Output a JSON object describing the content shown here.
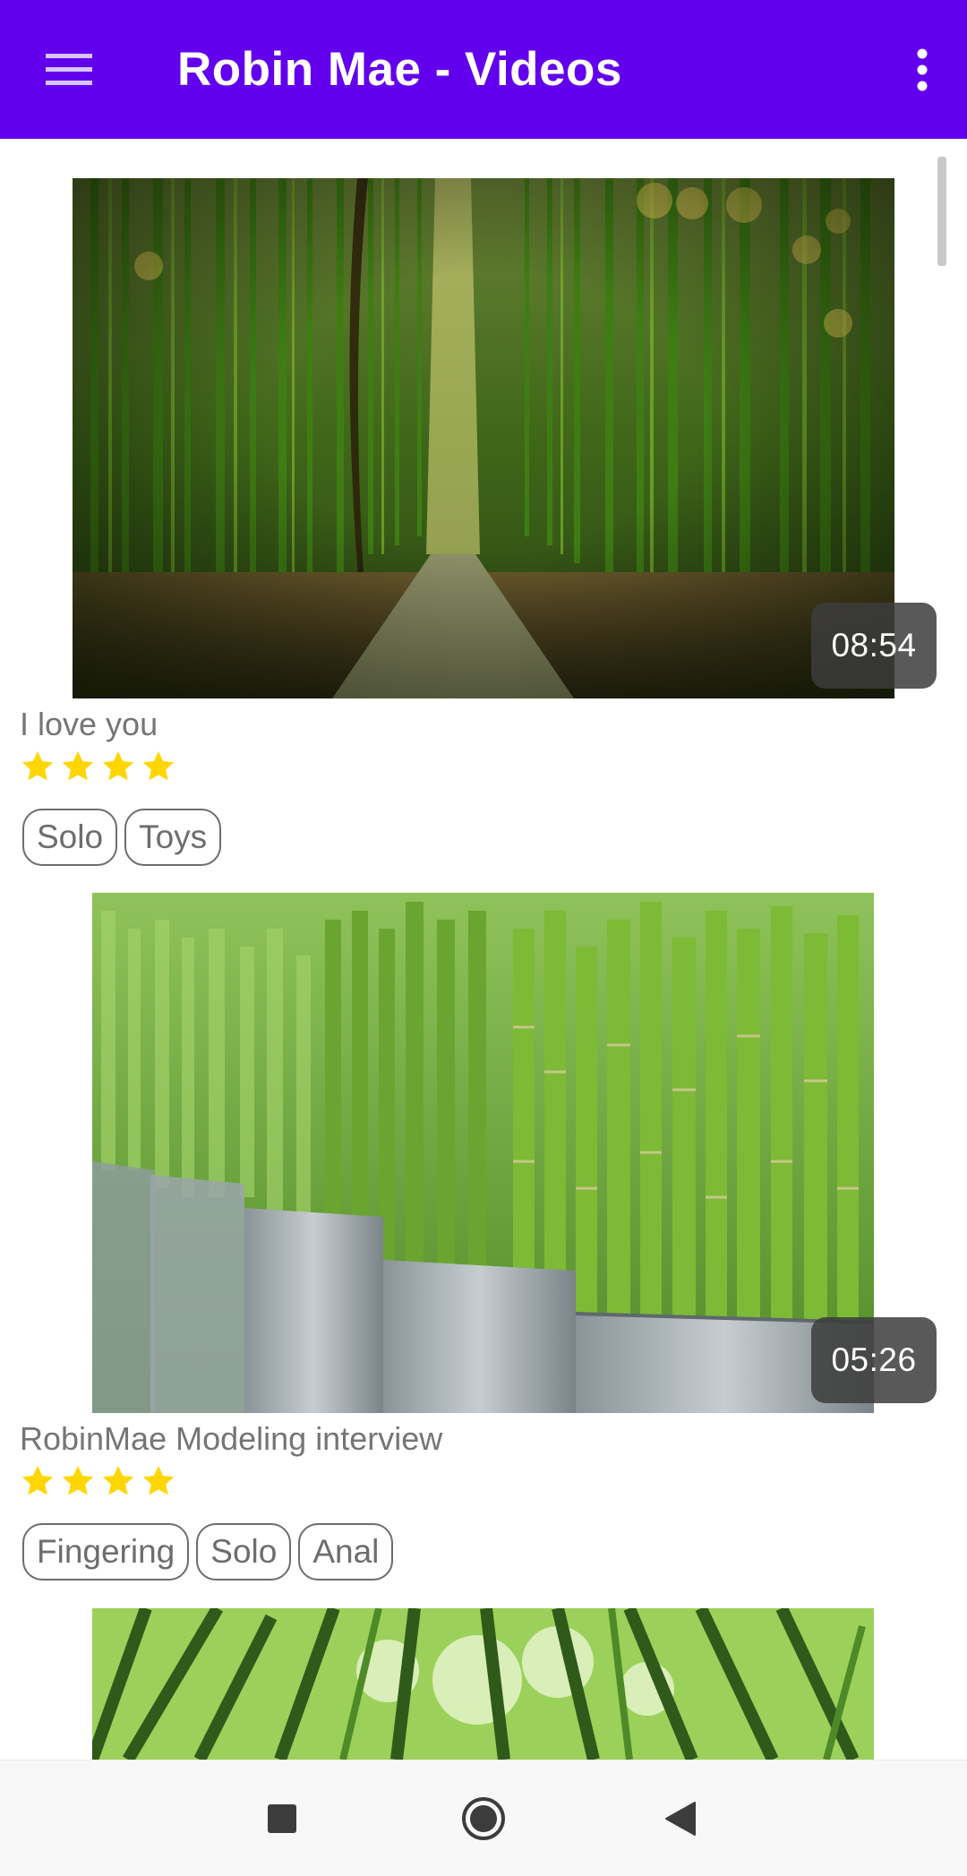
{
  "appbar": {
    "title": "Robin Mae - Videos",
    "color": "#6200ee",
    "menu_icon": "hamburger-menu-icon",
    "overflow_icon": "more-vertical-icon"
  },
  "videos": [
    {
      "duration": "08:54",
      "title": "I love you",
      "rating": 4,
      "tags": [
        "Solo",
        "Toys"
      ],
      "thumbnail": "bamboo forest path"
    },
    {
      "duration": "05:26",
      "title": "RobinMae Modeling interview",
      "rating": 4,
      "tags": [
        "Fingering",
        "Solo",
        "Anal"
      ],
      "thumbnail": "bamboo stalks in metal buckets"
    },
    {
      "thumbnail": "bamboo canopy looking up"
    }
  ],
  "star_color": "#ffd600",
  "navbar": {
    "recents_icon": "square-recents-icon",
    "home_icon": "circle-home-icon",
    "back_icon": "triangle-back-icon"
  }
}
